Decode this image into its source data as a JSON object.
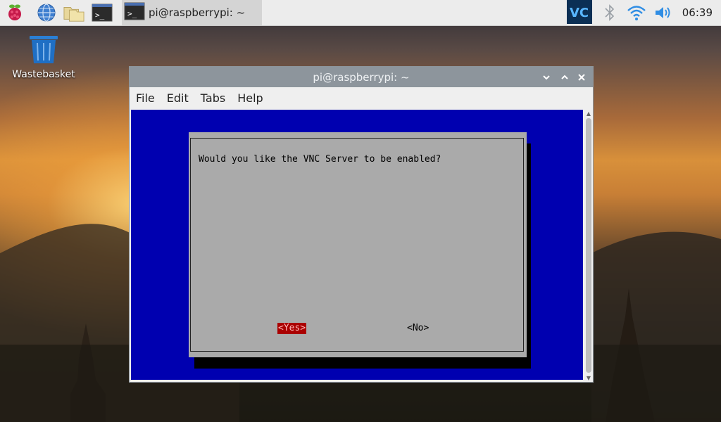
{
  "taskbar": {
    "clock": "06:39",
    "task_label": "pi@raspberrypi: ~",
    "icons": [
      "raspberry-menu-icon",
      "web-browser-icon",
      "file-manager-icon",
      "terminal-icon",
      "vnc-icon",
      "bluetooth-icon",
      "wifi-icon",
      "volume-icon"
    ]
  },
  "desktop": {
    "wastebasket_label": "Wastebasket"
  },
  "window": {
    "title": "pi@raspberrypi: ~",
    "menu": [
      "File",
      "Edit",
      "Tabs",
      "Help"
    ]
  },
  "dialog": {
    "question": "Would you like the VNC Server to be enabled?",
    "yes_label": "<Yes>",
    "no_label": "<No>"
  },
  "colors": {
    "terminal_bg": "#0000b0",
    "dialog_bg": "#aaaaaa",
    "selected_button_bg": "#aa0000",
    "titlebar": "#8d959c"
  }
}
